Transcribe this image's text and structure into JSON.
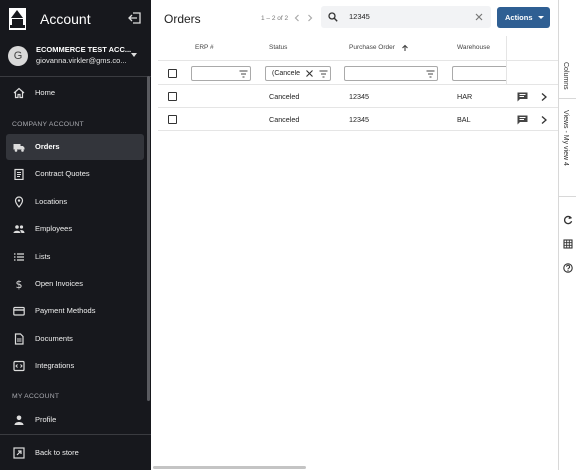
{
  "sidebar": {
    "title": "Account",
    "user": {
      "avatar_initial": "G",
      "company": "ECOMMERCE TEST ACC...",
      "email": "giovanna.virkler@gms.co..."
    },
    "home_label": "Home",
    "company_section": "COMPANY ACCOUNT",
    "company_items": [
      {
        "label": "Orders",
        "icon": "truck-icon",
        "active": true
      },
      {
        "label": "Contract Quotes",
        "icon": "clipboard-icon"
      },
      {
        "label": "Locations",
        "icon": "map-pin-icon"
      },
      {
        "label": "Employees",
        "icon": "people-icon"
      },
      {
        "label": "Lists",
        "icon": "list-icon"
      },
      {
        "label": "Open Invoices",
        "icon": "dollar-icon"
      },
      {
        "label": "Payment Methods",
        "icon": "credit-card-icon"
      },
      {
        "label": "Documents",
        "icon": "document-icon"
      },
      {
        "label": "Integrations",
        "icon": "code-icon"
      }
    ],
    "my_account_section": "MY ACCOUNT",
    "profile_label": "Profile",
    "back_label": "Back to store"
  },
  "main": {
    "title": "Orders",
    "pager_text": "1 – 2 of 2",
    "search": {
      "value": "12345"
    },
    "actions_label": "Actions"
  },
  "grid": {
    "columns": [
      "ERP #",
      "Status",
      "Purchase Order",
      "Warehouse"
    ],
    "sort": {
      "column": "Purchase Order",
      "direction": "ascending"
    },
    "filters": {
      "erp": "",
      "status": "(Canceled",
      "purchase_order": "",
      "warehouse": ""
    },
    "rows": [
      {
        "erp": "",
        "status": "Canceled",
        "purchase_order": "12345",
        "warehouse": "HAR"
      },
      {
        "erp": "",
        "status": "Canceled",
        "purchase_order": "12345",
        "warehouse": "BAL"
      }
    ]
  },
  "rail": {
    "columns_label": "Columns",
    "views_label": "Views - My view 4",
    "icons": [
      "refresh-icon",
      "table-icon",
      "help-icon"
    ]
  },
  "colors": {
    "sidebar_bg": "#17181d",
    "active_item_bg": "#33353b",
    "accent": "#2f5f93"
  }
}
